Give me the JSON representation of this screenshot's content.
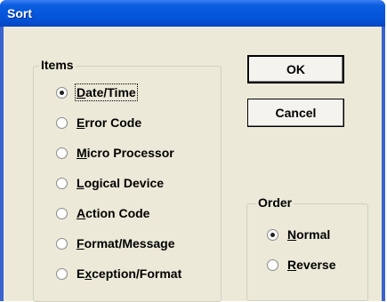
{
  "window": {
    "title": "Sort"
  },
  "items_group": {
    "label": "Items",
    "options": [
      {
        "label": "Date/Time",
        "mnemonic": "D",
        "checked": true
      },
      {
        "label": "Error Code",
        "mnemonic": "E",
        "checked": false
      },
      {
        "label": "Micro Processor",
        "mnemonic": "M",
        "checked": false
      },
      {
        "label": "Logical Device",
        "mnemonic": "L",
        "checked": false
      },
      {
        "label": "Action Code",
        "mnemonic": "A",
        "checked": false
      },
      {
        "label": "Format/Message",
        "mnemonic": "F",
        "checked": false
      },
      {
        "label": "Exception/Format",
        "mnemonic": "x",
        "checked": false
      }
    ]
  },
  "order_group": {
    "label": "Order",
    "options": [
      {
        "label": "Normal",
        "mnemonic": "N",
        "checked": true
      },
      {
        "label": "Reverse",
        "mnemonic": "R",
        "checked": false
      }
    ]
  },
  "buttons": {
    "ok": "OK",
    "cancel": "Cancel"
  }
}
